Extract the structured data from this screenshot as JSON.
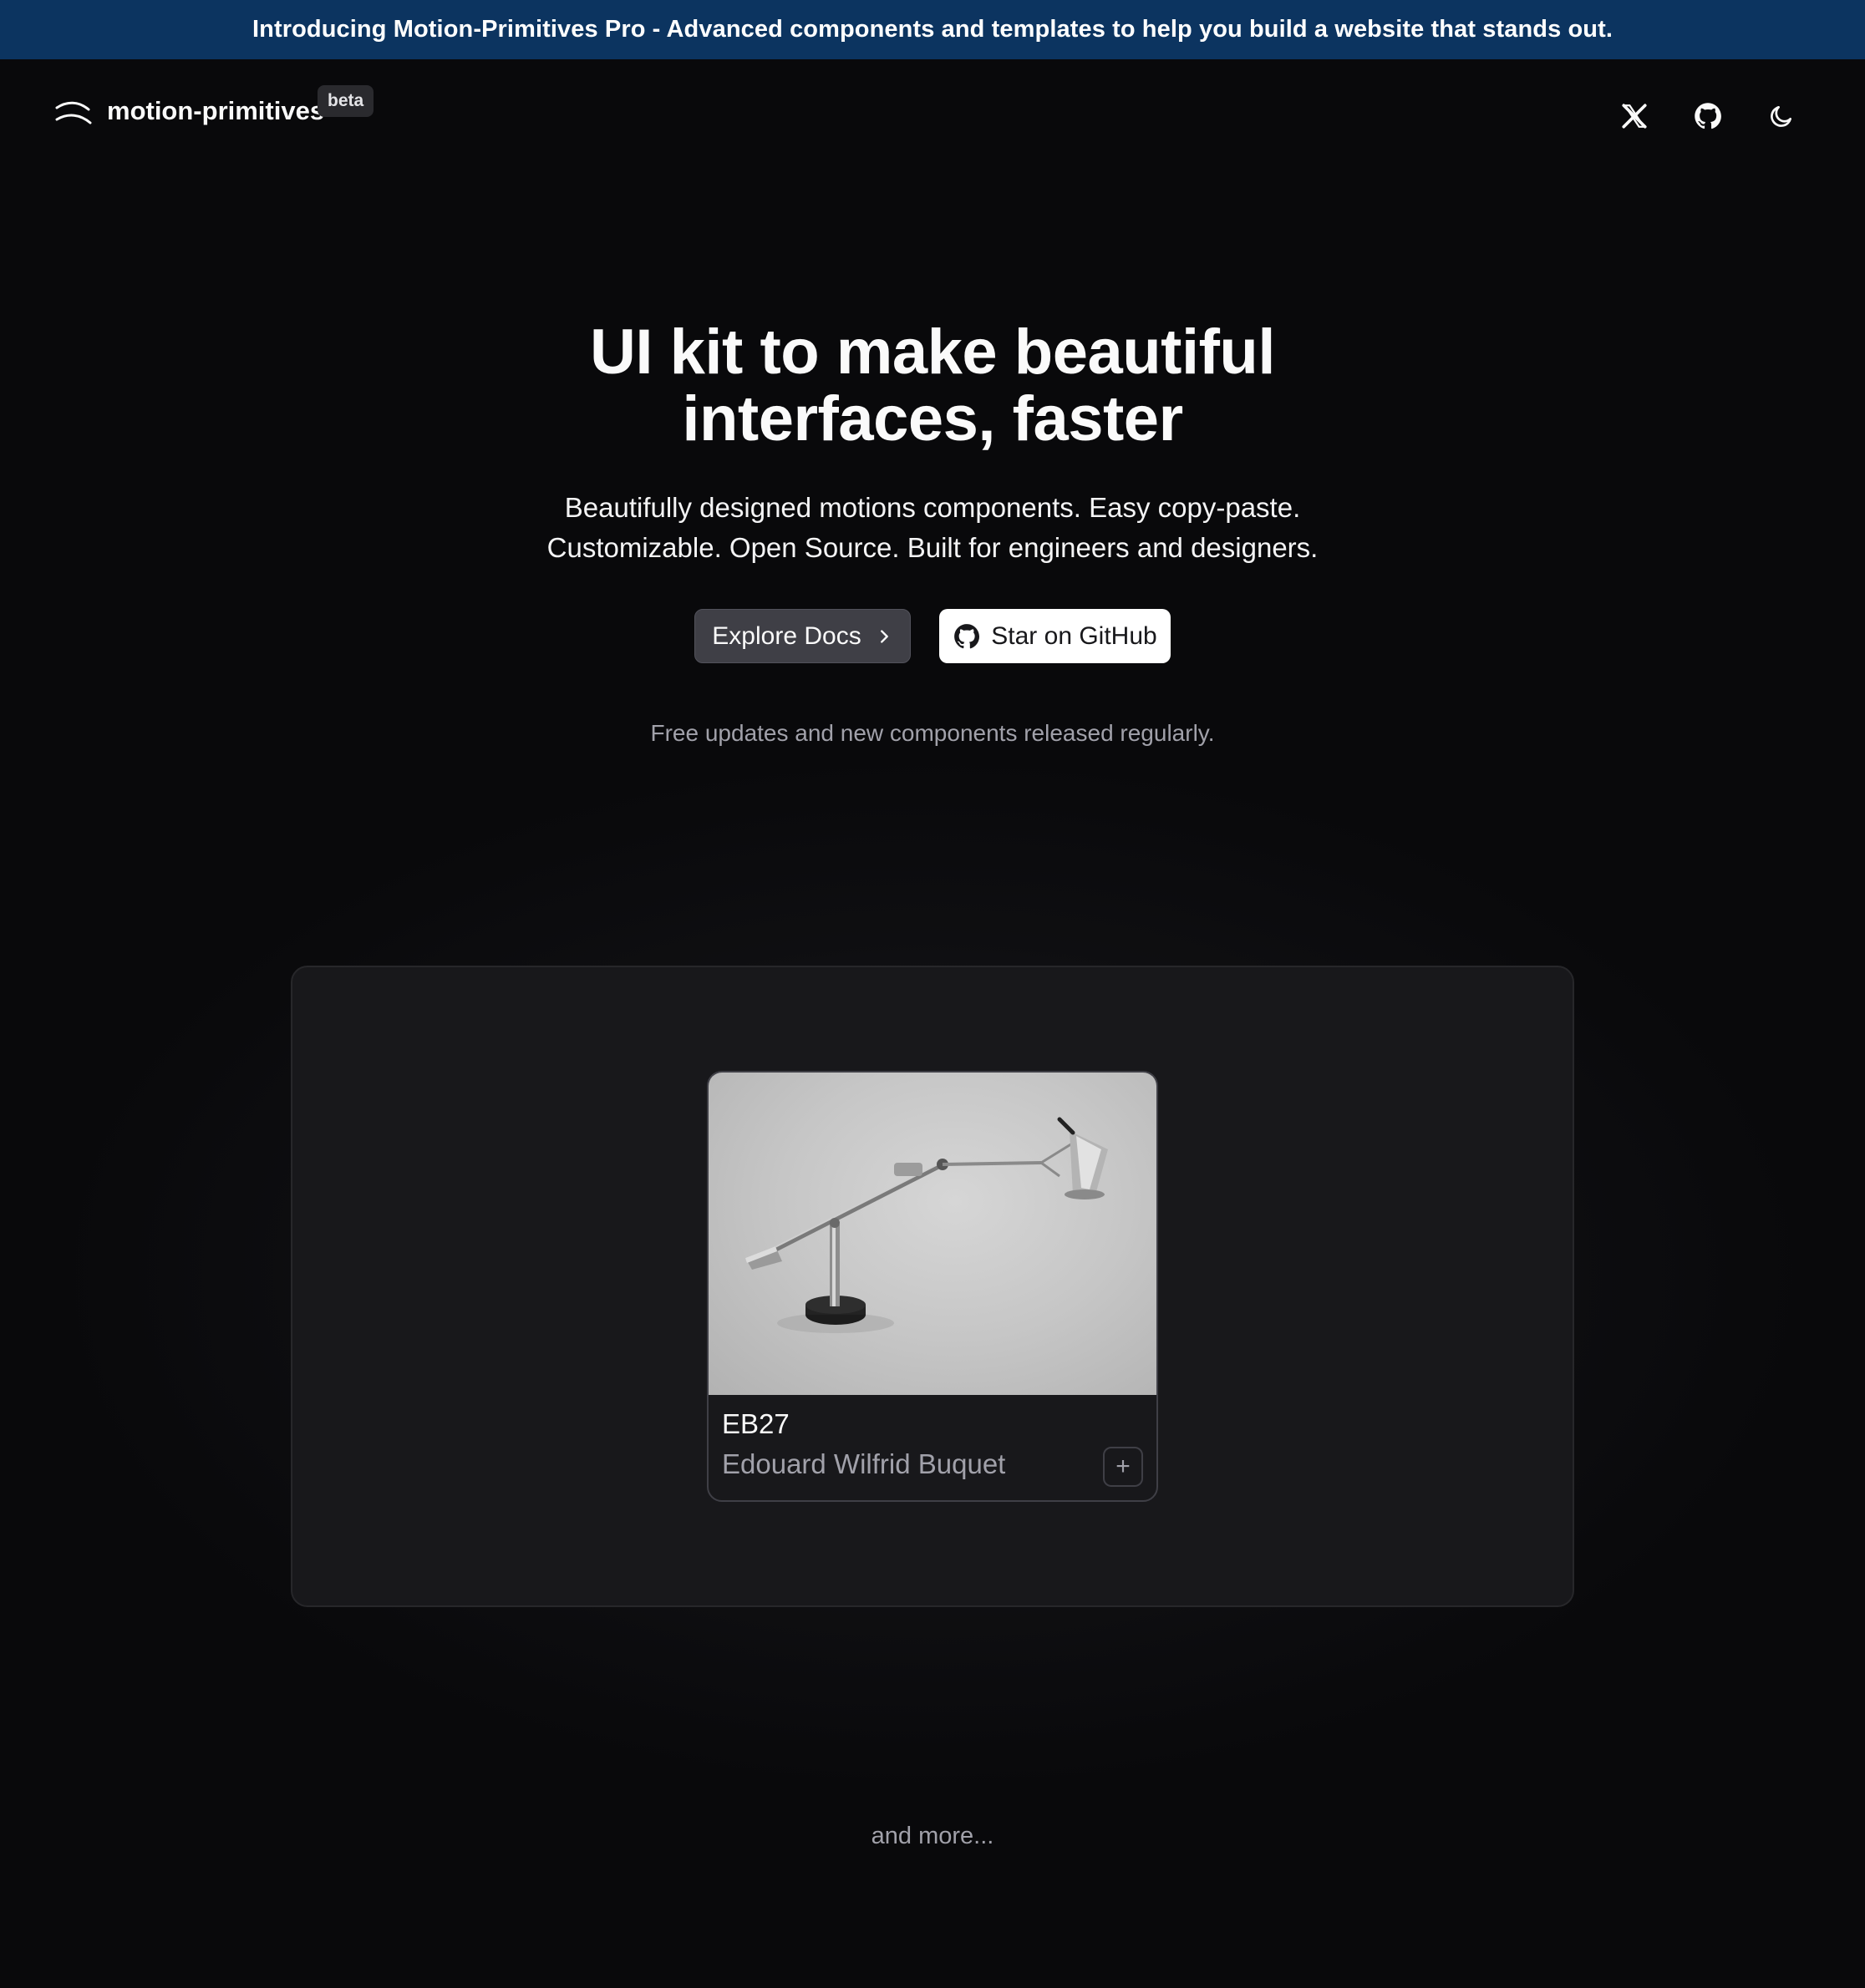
{
  "banner": {
    "text": "Introducing Motion-Primitives Pro - Advanced components and templates to help you build a website that stands out."
  },
  "header": {
    "logo_text": "motion-primitives",
    "badge": "beta",
    "icons": [
      "x-logo-icon",
      "github-icon",
      "moon-icon"
    ]
  },
  "hero": {
    "title_line1": "UI kit to make beautiful",
    "title_line2": "interfaces, faster",
    "subtitle_line1": "Beautifully designed motions components. Easy copy-paste.",
    "subtitle_line2": "Customizable. Open Source. Built for engineers and designers.",
    "primary_button": "Explore Docs",
    "secondary_button": "Star on GitHub",
    "note": "Free updates and new components released regularly."
  },
  "demo": {
    "card": {
      "title": "EB27",
      "subtitle": "Edouard Wilfrid Buquet",
      "action": "+"
    }
  },
  "footer": {
    "more_text": "and more..."
  },
  "colors": {
    "background": "#09090b",
    "banner": "#0c3460",
    "panel": "#18181b",
    "muted_text": "#a1a1aa"
  }
}
